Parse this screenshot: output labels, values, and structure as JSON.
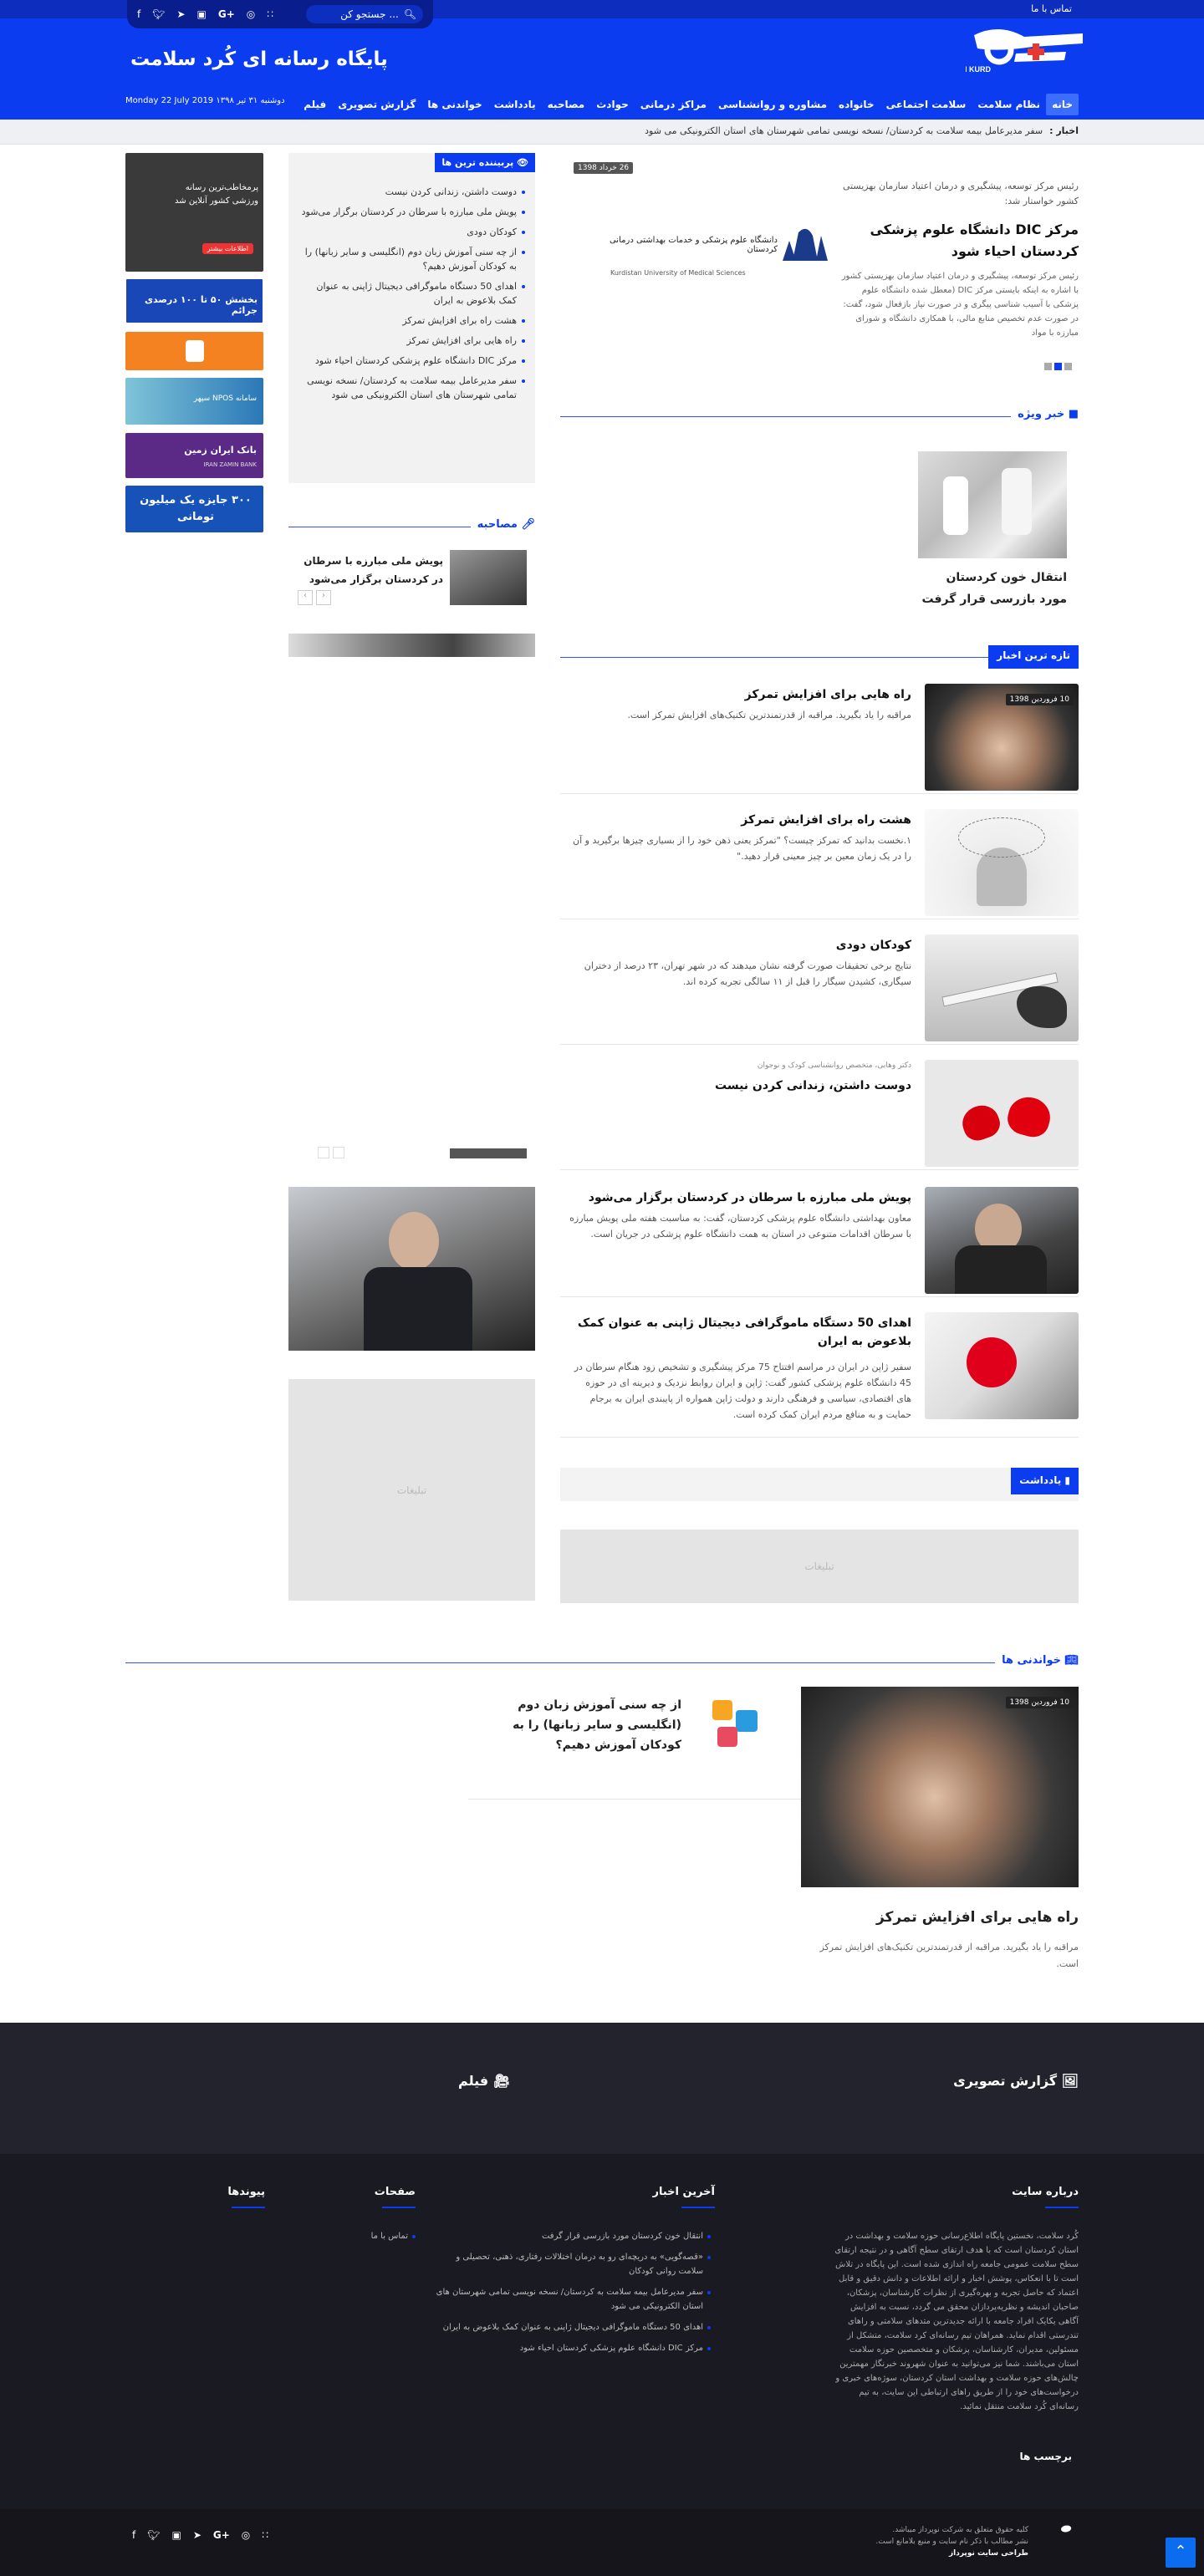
{
  "header": {
    "contact": "تماس با ما",
    "search_placeholder": "جستجو کن ...",
    "site_title": "پایگاه رسانه ای کُرد سلامت",
    "date": "Monday 22 July 2019 دوشنبه ۳۱ تیر ۱۳۹۸",
    "logo_text": "HEALTH KURD",
    "social": [
      "f",
      "t",
      "tg",
      "ig",
      "g+",
      "dr",
      "rss"
    ]
  },
  "nav": [
    "خانه",
    "نظام سلامت",
    "سلامت اجتماعی",
    "خانواده",
    "مشاوره و روانشناسی",
    "مراکز درمانی",
    "حوادث",
    "مصاحبه",
    "یادداشت",
    "خواندنی ها",
    "گزارش تصویری",
    "فیلم"
  ],
  "ticker": {
    "label": "اخبار :",
    "text": "سفر مدیرعامل بیمه سلامت به کردستان/ نسخه نویسی تمامی شهرستان های استان الکترونیکی می شود"
  },
  "slider": {
    "meta": "رئیس مرکز توسعه، پیشگیری و درمان اعتیاد سازمان بهزیستی کشور خواستار شد:",
    "title": "مرکز DIC دانشگاه علوم پزشکی کردستان احیاء شود",
    "body": "رئیس مرکز توسعه، پیشگیری و درمان اعتیاد سازمان بهزیستی کشور با اشاره به اینکه بایستی مرکز DIC (معطل شده دانشگاه علوم پزشکی با آسیب شناسی پیگری و در صورت نیاز بازفعال شود، گفت: در صورت عدم تخصیص منابع مالی، با همکاری دانشگاه و شورای مبارزه با مواد",
    "date": "26 خرداد 1398",
    "uni_name": "دانشگاه علوم پزشکی و خدمات بهداشتی درمانی کردستان",
    "uni_en": "Kurdistan University of Medical Sciences"
  },
  "popular": {
    "title": "پربیننده ترین ها",
    "items": [
      "دوست داشتن، زندانی کردن نیست",
      "پویش ملی مبارزه با سرطان در کردستان برگزار می‌شود",
      "کودکان دودی",
      "از چه سنی آموزش زبان دوم (انگلیسی و سایر زبانها) را به کودکان آموزش دهیم؟",
      "اهدای 50 دستگاه ماموگرافی دیجیتال ژاپنی به عنوان کمک بلاعوض به ایران",
      "هشت راه برای افزایش تمرکز",
      "راه هایی برای افزایش تمرکز",
      "مرکز DIC دانشگاه علوم پزشکی کردستان احیاء شود",
      "سفر مدیرعامل بیمه سلامت به کردستان/ نسخه نویسی تمامی شهرستان های استان الکترونیکی می شود"
    ]
  },
  "interview": {
    "title": "مصاحبه",
    "item": "پویش ملی مبارزه با سرطان در کردستان برگزار می‌شود"
  },
  "special": {
    "title": "خبر ویژه",
    "item": "انتقال خون کردستان مورد بازرسی قرار گرفت"
  },
  "latest": {
    "title": "تازه ترین اخبار",
    "items": [
      {
        "title": "راه هایی برای افزایش تمرکز",
        "text": "مراقبه را یاد بگیرید. مراقبه از قدرتمندترین تکنیک‌های افزایش تمرکز است.",
        "badge": "10 فروردین 1398",
        "meta": ""
      },
      {
        "title": "هشت راه برای افزایش تمرکز",
        "text": "۱.نخست بدانید که تمرکز چیست؟ \"تمرکز یعنی ذهن خود را از بسیاری چیزها برگیرید و آن را در یک زمان معین بر چیز معینی قرار دهید.\"",
        "badge": "",
        "meta": ""
      },
      {
        "title": "کودکان دودی",
        "text": "نتایج برخی تحقیقات صورت گرفته نشان میدهند که در شهر تهران، ۲۳ درصد از دختران سیگاری، کشیدن سیگار را قبل از ۱۱ سالگی تجربه کرده اند.",
        "badge": "",
        "meta": ""
      },
      {
        "title": "دوست داشتن، زندانی کردن نیست",
        "text": "",
        "badge": "",
        "meta": "دکتر وهابی، متخصص روانشناسی کودک و نوجوان"
      },
      {
        "title": "پویش ملی مبارزه با سرطان در کردستان برگزار می‌شود",
        "text": "معاون بهداشتی دانشگاه علوم پزشکی کردستان، گفت: به مناسبت هفته ملی پویش مبارزه با سرطان اقدامات متنوعی در استان به همت دانشگاه علوم پزشکی در جریان است.",
        "badge": "",
        "meta": ""
      },
      {
        "title": "اهدای 50 دستگاه ماموگرافی دیجیتال ژاپنی به عنوان کمک بلاعوض به ایران",
        "text": "سفیر ژاپن در ایران در مراسم افتتاح 75 مرکز پیشگیری و تشخیص زود هنگام سرطان در 45 دانشگاه علوم پزشکی کشور گفت: ژاپن و ایران روابط نزدیک و دیرینه ای در حوزه های اقتصادی، سیاسی و فرهنگی دارند و دولت ژاپن همواره از پایبندی ایران به برجام حمایت و به منافع مردم ایران کمک کرده است.",
        "badge": "",
        "meta": ""
      }
    ]
  },
  "note": {
    "title": "یادداشت"
  },
  "ad_label": "تبلیغات",
  "readings": {
    "title": "خواندنی ها",
    "main_title": "راه هایی برای افزایش تمرکز",
    "main_text": "مراقبه را یاد بگیرید. مراقبه از قدرتمندترین تکنیک‌های افزایش تمرکز است.",
    "main_badge": "10 فروردین 1398",
    "side_title": "از چه سنی آموزش زبان دوم (انگلیسی و سایر زبانها) را به کودکان آموزش دهیم؟"
  },
  "ads": {
    "ad1": "پرمخاطب‌ترین رسانه ورزشی کشور آنلاین شد",
    "ad1_btn": "اطلاعات بیشتر",
    "ad2": "بخشش ۵۰ تا ۱۰۰ درصدی جرائم",
    "ad4": "سامانه NPOS سپهر",
    "ad5": "بانک ایران زمین",
    "ad5_en": "IRAN ZAMIN BANK",
    "ad6": "۳۰۰ جایزه یک میلیون تومانی"
  },
  "footer": {
    "gallery": "گزارش تصویری",
    "film": "فیلم",
    "about_title": "درباره سایت",
    "about_text": "کُرد سلامت، نخستین پایگاه اطلاع‌رسانی حوزه سلامت و بهداشت در استان کردستان است که با هدف ارتقای سطح آگاهی و در نتیجه ارتقای سطح سلامت عمومی جامعه راه اندازی شده است. این پایگاه در تلاش است تا با انعکاس، پوشش اخبار و ارائه اطلاعات و دانش دقیق و قابل اعتماد که حاصل تجربه و بهره‌گیری از نظرات کارشناسان، پزشکان، صاحبان اندیشه و نظریه‌پردازان محقق می گردد، نسبت به افزایش آگاهی یکایک افراد جامعه با ارائه جدیدترین متدهای سلامتی و راهای تندرستی اقدام نماید. همراهان تیم رسانه‌ای کرد سلامت، متشکل از مسئولین، مدیران، کارشناسان، پزشکان و متخصصین حوزه سلامت استان می‌باشند. شما نیز می‌توانید به عنوان شهروند خبرنگار مهمترین چالش‌های حوزه سلامت و بهداشت استان کردستان، سوژه‌های خبری و درخواست‌های خود را از طریق راهای ارتباطی این سایت، به تیم رسانه‌ای کُرد سلامت منتقل نمائید.",
    "tags_title": "برچسب ها",
    "latest_title": "آخرین اخبار",
    "latest": [
      "انتقال خون کردستان مورد بازرسی قرار گرفت",
      "«قصه‌گویی» به دریچه‌ای رو به درمان اختلالات رفتاری، ذهنی، تحصیلی و سلامت روانی کودکان",
      "سفر مدیرعامل بیمه سلامت به کردستان/ نسخه نویسی تمامی شهرستان های استان الکترونیکی می شود",
      "اهدای 50 دستگاه ماموگرافی دیجیتال ژاپنی به عنوان کمک بلاعوض به ایران",
      "مرکز DIC دانشگاه علوم پزشکی کردستان احیاء شود"
    ],
    "pages_title": "صفحات",
    "pages": [
      "تماس با ما"
    ],
    "links_title": "پیوندها",
    "copyright1": "کلیه حقوق متعلق به شرکت نوپرداز میباشد.",
    "copyright2": "نشر مطالب با ذکر نام سایت و منبع بلامانع است.",
    "copyright3": "طراحی سایت نوپرداز"
  }
}
